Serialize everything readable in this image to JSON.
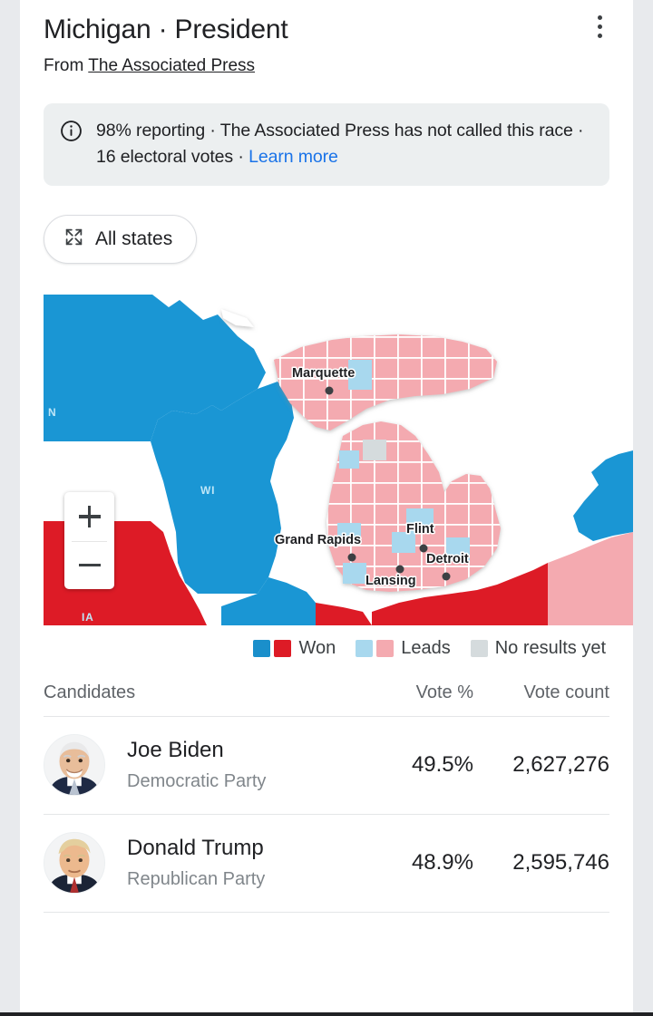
{
  "header": {
    "title": "Michigan · President",
    "source_prefix": "From ",
    "source_name": "The Associated Press",
    "overflow_icon": "more-vert-icon"
  },
  "banner": {
    "icon": "info-circle-icon",
    "text": "98% reporting · The Associated Press has not called this race · 16 electoral votes · ",
    "link_label": "Learn more"
  },
  "controls": {
    "all_states_label": "All states",
    "all_states_icon": "expand-arrows-icon",
    "zoom_in_label": "+",
    "zoom_out_label": "−"
  },
  "map": {
    "state_labels": [
      "N",
      "WI",
      "IA"
    ],
    "city_labels": [
      "Marquette",
      "Grand Rapids",
      "Flint",
      "Detroit",
      "Lansing"
    ],
    "colors": {
      "won_blue": "#1a96d4",
      "won_red": "#dd1b26",
      "leads_blue": "#a8d8ee",
      "leads_pink": "#f4aab0",
      "no_results_gray": "#d5dbdd",
      "water": "#ffffff",
      "county_border": "#ffffff"
    }
  },
  "legend": {
    "items": [
      {
        "label": "Won",
        "swatches": [
          "#1a8fcb",
          "#dd1b26"
        ]
      },
      {
        "label": "Leads",
        "swatches": [
          "#a8d8ee",
          "#f4aab0"
        ]
      },
      {
        "label": "No results yet",
        "swatches": [
          "#d5dbdd"
        ]
      }
    ]
  },
  "table": {
    "columns": {
      "candidates": "Candidates",
      "vote_pct": "Vote %",
      "vote_count": "Vote count"
    },
    "rows": [
      {
        "name": "Joe Biden",
        "party": "Democratic Party",
        "vote_pct": "49.5%",
        "vote_count": "2,627,276",
        "avatar": "joe-biden-portrait"
      },
      {
        "name": "Donald Trump",
        "party": "Republican Party",
        "vote_pct": "48.9%",
        "vote_count": "2,595,746",
        "avatar": "donald-trump-portrait"
      }
    ]
  }
}
